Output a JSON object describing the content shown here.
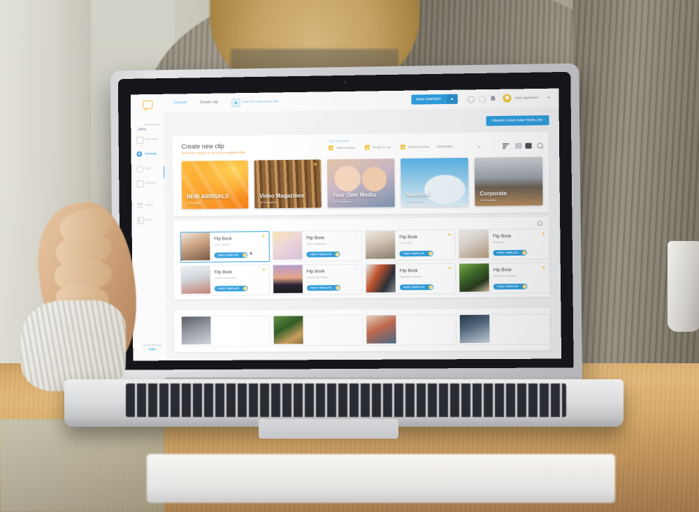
{
  "app": {
    "topbar": {
      "logo_icon": "chat-bubble-logo",
      "breadcrumb": {
        "root": "Content",
        "separator": "-",
        "current": "Create clip"
      },
      "howto_icon": "video-play-icon",
      "howto_label": "How To create a new clip",
      "new_content_button": "NEW CONTENT",
      "help_icon": "help-circle-icon",
      "refresh_icon": "refresh-icon",
      "notifications_icon": "bell-icon",
      "avatar_icon": "user-avatar",
      "user_name": "John Appleseed",
      "user_caret_icon": "chevron-down-icon"
    },
    "sidebar": {
      "items": [
        {
          "label": "Dashboard",
          "icon": "home-icon",
          "active": false
        },
        {
          "label": "Overview",
          "icon": "grid-icon",
          "active": false
        },
        {
          "label": "Content",
          "icon": "content-dot-icon",
          "active": true
        },
        {
          "label": "Play",
          "icon": "play-ring-icon",
          "active": false
        },
        {
          "label": "Players",
          "icon": "display-icon",
          "active": false
        },
        {
          "label": "Users",
          "icon": "users-icon",
          "active": false
        },
        {
          "label": "More",
          "icon": "more-panel-icon",
          "active": false
        }
      ],
      "greeting_line1": "Good morning,",
      "greeting_line2": "John"
    },
    "main": {
      "create_template_button": "CREATE YOUR OWN TEMPLATE",
      "page_title": "Create new clip",
      "page_subtitle": "Select first category to see all the templates within",
      "filters": {
        "group_label": "Type of template",
        "checkboxes": [
          {
            "label": "Video template",
            "checked": true
          },
          {
            "label": "Ready for use",
            "checked": true
          },
          {
            "label": "Region template",
            "checked": true
          }
        ],
        "orientation_select": "Orientation",
        "view_icons": [
          "sort-icon",
          "grid-view-icon",
          "list-view-icon",
          "search-icon"
        ]
      },
      "categories": [
        {
          "title": "NEW ARRIVALS",
          "count": "7 Templates",
          "starred": false,
          "theme": "bg-new"
        },
        {
          "title": "Video Magazines",
          "count": "38 Templates",
          "starred": true,
          "theme": "bg-mag"
        },
        {
          "title": "Your Own Media",
          "count": "127 Templates",
          "starred": false,
          "theme": "bg-own"
        },
        {
          "title": "Seasonal",
          "count": "14 Templates",
          "starred": false,
          "theme": "bg-sea"
        },
        {
          "title": "Corporate",
          "count": "14 Templates",
          "starred": false,
          "theme": "bg-corp"
        }
      ],
      "grid_search_icon": "search-icon",
      "badge_label": "VIDEO TEMPLATE",
      "templates": [
        {
          "name": "Flip Book",
          "sub": "News Widget",
          "starred": true,
          "selected": true,
          "thumb": "th-a"
        },
        {
          "name": "Flip Book",
          "sub": "Video Magazine",
          "starred": false,
          "selected": false,
          "thumb": "th-b"
        },
        {
          "name": "Flip Book",
          "sub": "Corporate",
          "starred": true,
          "selected": false,
          "thumb": "th-c"
        },
        {
          "name": "Flip Book",
          "sub": "Seasonal",
          "starred": true,
          "selected": false,
          "thumb": "th-d"
        },
        {
          "name": "Flip Book",
          "sub": "Slideshow Widget",
          "starred": true,
          "selected": false,
          "thumb": "th-e"
        },
        {
          "name": "Flip Book",
          "sub": "Slideshow Widget",
          "starred": false,
          "selected": false,
          "thumb": "th-f"
        },
        {
          "name": "Flip Book",
          "sub": "Slideshow Widget",
          "starred": true,
          "selected": false,
          "thumb": "th-g"
        },
        {
          "name": "Flip Book",
          "sub": "Slideshow Widget",
          "starred": true,
          "selected": false,
          "thumb": "th-h"
        }
      ],
      "templates_row3": [
        {
          "thumb": "th-i"
        },
        {
          "thumb": "th-j"
        },
        {
          "thumb": "th-k"
        },
        {
          "thumb": "th-l"
        }
      ]
    },
    "colors": {
      "accent_blue": "#2f9fe0",
      "accent_yellow": "#f6c944",
      "orange_text": "#e8a33d",
      "muted_text": "#b3b8bf"
    }
  }
}
